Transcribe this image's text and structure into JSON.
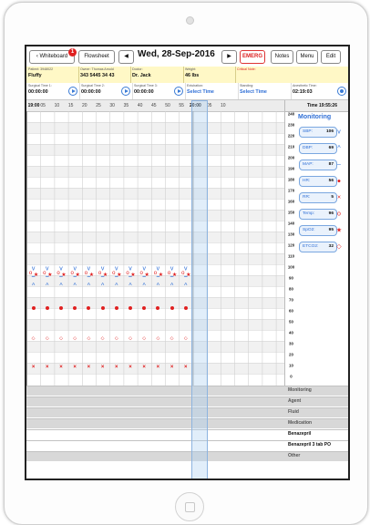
{
  "nav": {
    "whiteboard_label": "Whiteboard",
    "whiteboard_badge": "1",
    "flowsheet_label": "Flowsheet",
    "prev_label": "◀",
    "date": "Wed, 28-Sep-2016",
    "next_label": "▶",
    "emerg_label": "EMERG",
    "notes_label": "Notes",
    "menu_label": "Menu",
    "edit_label": "Edit"
  },
  "info": {
    "patient_label": "Patient: 3948022",
    "patient_name": "Fluffy",
    "owner_label": "Owner: Thomas Arnold",
    "owner_phone": "343 5445 34 43",
    "doctor_label": "Doctor:",
    "doctor_name": "Dr. Jack",
    "weight_label": "Weight:",
    "weight_value": "46 lbs",
    "critical_label": "Critical Note:"
  },
  "times": {
    "surgical1_label": "Surgical Time 1:",
    "surgical1_value": "00:00:00",
    "surgical2_label": "Surgical Time 2:",
    "surgical2_value": "00:00:00",
    "surgical3_label": "Surgical Time 3:",
    "surgical3_value": "00:00:00",
    "extubation_label": "Extubation:",
    "extubation_value": "Select Time",
    "standing_label": "Standing:",
    "standing_value": "Select Time",
    "anesthetic_label": "Anesthetic Time:",
    "anesthetic_value": "02:19:03"
  },
  "timeline": {
    "ticks": [
      "19:00",
      "05",
      "10",
      "15",
      "20",
      "25",
      "30",
      "35",
      "40",
      "45",
      "50",
      "55",
      "20:00",
      "05",
      "10"
    ],
    "current_time": "Time 19:55:26"
  },
  "axis_labels": [
    "240",
    "230",
    "220",
    "210",
    "200",
    "190",
    "180",
    "170",
    "160",
    "150",
    "140",
    "130",
    "120",
    "110",
    "100",
    "90",
    "80",
    "70",
    "60",
    "50",
    "40",
    "30",
    "20",
    "10",
    "0"
  ],
  "monitoring": {
    "title": "Monitoring",
    "params": [
      {
        "name": "SBP:",
        "value": "106",
        "symbol": "v",
        "color": "#2f6fd6"
      },
      {
        "name": "DBP:",
        "value": "69",
        "symbol": "^",
        "color": "#2f6fd6"
      },
      {
        "name": "MAP:",
        "value": "87",
        "symbol": "–",
        "color": "#2f6fd6"
      },
      {
        "name": "HR:",
        "value": "56",
        "symbol": "●",
        "color": "#e02020"
      },
      {
        "name": "RR:",
        "value": "5",
        "symbol": "×",
        "color": "#e02020"
      },
      {
        "name": "Temp:",
        "value": "96",
        "symbol": "o",
        "color": "#e02020"
      },
      {
        "name": "SpO2:",
        "value": "95",
        "symbol": "★",
        "color": "#e02020"
      },
      {
        "name": "ETCO2:",
        "value": "32",
        "symbol": "◇",
        "color": "#e02020"
      }
    ]
  },
  "sections": [
    {
      "label": "Monitoring",
      "style": "grey"
    },
    {
      "label": "Agent",
      "style": "grey"
    },
    {
      "label": "Fluid",
      "style": "grey"
    },
    {
      "label": "Medication",
      "style": "grey"
    },
    {
      "label": "Benazepril",
      "style": "white"
    },
    {
      "label": "Benazepril 3 tab PO",
      "style": "white"
    },
    {
      "label": "Other",
      "style": "grey"
    }
  ],
  "vitals_series": {
    "sbp": [
      96,
      96,
      96,
      96,
      96,
      96,
      96,
      96,
      96,
      96,
      96,
      96
    ],
    "dbp": [
      80,
      80,
      80,
      80,
      80,
      80,
      80,
      80,
      80,
      80,
      80,
      80
    ],
    "map": [
      88,
      88,
      88,
      88,
      88,
      88,
      88,
      88,
      88,
      88,
      88,
      88
    ],
    "hr": [
      60,
      60,
      60,
      60,
      60,
      60,
      60,
      60,
      60,
      60,
      60,
      60
    ],
    "rr": [
      6,
      6,
      6,
      6,
      6,
      6,
      6,
      6,
      6,
      6,
      6,
      6
    ],
    "temp": [
      92,
      92,
      92,
      92,
      92,
      92,
      92,
      92,
      92,
      92,
      92,
      92
    ],
    "spo2": [
      90,
      90,
      90,
      90,
      90,
      90,
      90,
      90,
      90,
      90,
      90,
      90
    ],
    "etco2": [
      32,
      32,
      32,
      32,
      32,
      32,
      32,
      32,
      32,
      32,
      32,
      32
    ]
  }
}
